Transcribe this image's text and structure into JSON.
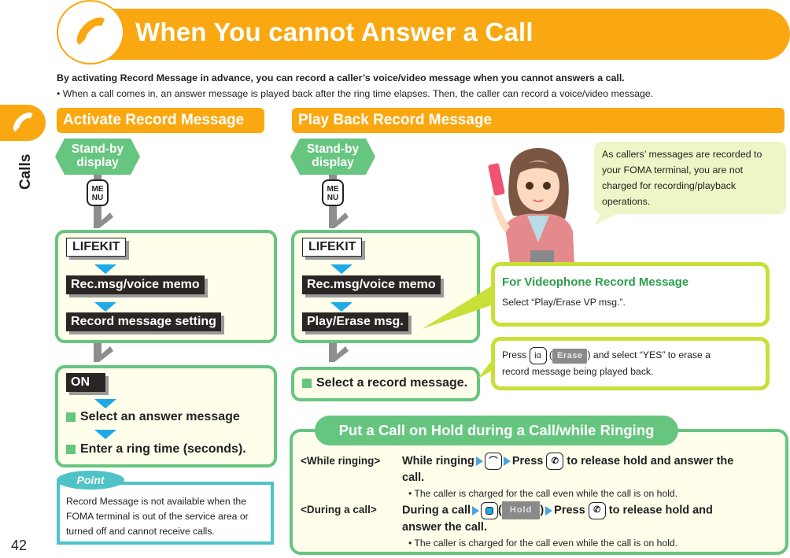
{
  "header": {
    "title": "When You cannot Answer a Call",
    "icon": "phone-handset-icon",
    "intro_bold": "By activating Record Message in advance, you can record a caller’s voice/video message when you cannot answers a call.",
    "intro_bullet": "• When a call comes in, an answer message is played back after the ring time elapses. Then, the caller can record a voice/video message."
  },
  "side_tab": {
    "label": "Calls",
    "icon": "phone-handset-icon"
  },
  "page_number": "42",
  "activate": {
    "heading": "Activate Record Message",
    "standby": [
      "Stand-by",
      "display"
    ],
    "menu_key": [
      "ME",
      "NU"
    ],
    "menu_path": [
      "LIFEKIT",
      "Rec.msg/voice memo",
      "Record message setting"
    ],
    "option": "ON",
    "steps": [
      "Select an answer message",
      "Enter a ring time (seconds)."
    ]
  },
  "point": {
    "tag": "Point",
    "text": "Record Message is not available when the FOMA terminal is out of the service area or turned off and cannot receive calls."
  },
  "playback": {
    "heading": "Play Back Record Message",
    "standby": [
      "Stand-by",
      "display"
    ],
    "menu_key": [
      "ME",
      "NU"
    ],
    "menu_path": [
      "LIFEKIT",
      "Rec.msg/voice memo",
      "Play/Erase msg."
    ],
    "step": "Select a record message.",
    "bubble": "As callers’ messages are recorded to your FOMA terminal, you are not charged for recording/playback operations.",
    "videophone": {
      "title": "For Videophone Record Message",
      "text": "Select “Play/Erase VP msg.”."
    },
    "erase_note": {
      "press": "Press",
      "key_label": "iα",
      "softkey": "Erase",
      "rest_line1": ") and select “YES” to erase a",
      "rest_line2": "record message being played back."
    }
  },
  "hold": {
    "heading": "Put a Call on Hold during a Call/while Ringing",
    "rows": [
      {
        "label": "<While ringing>",
        "part1": "While ringing",
        "part2": "Press",
        "part3": "to release hold and answer the",
        "line2": "call.",
        "note": "• The caller is charged for the call even while the call is on hold."
      },
      {
        "label": "<During a call>",
        "part1": "During a call",
        "softkey": "Hold",
        "part2": "Press",
        "part3": "to release hold and",
        "line2": "answer the call.",
        "note": "• The caller is charged for the call even while the call is on hold."
      }
    ]
  },
  "colors": {
    "orange": "#f9a812",
    "green": "#66c57f",
    "lime": "#c8e037",
    "teal": "#4fc3c7",
    "blue": "#1eaae7"
  }
}
